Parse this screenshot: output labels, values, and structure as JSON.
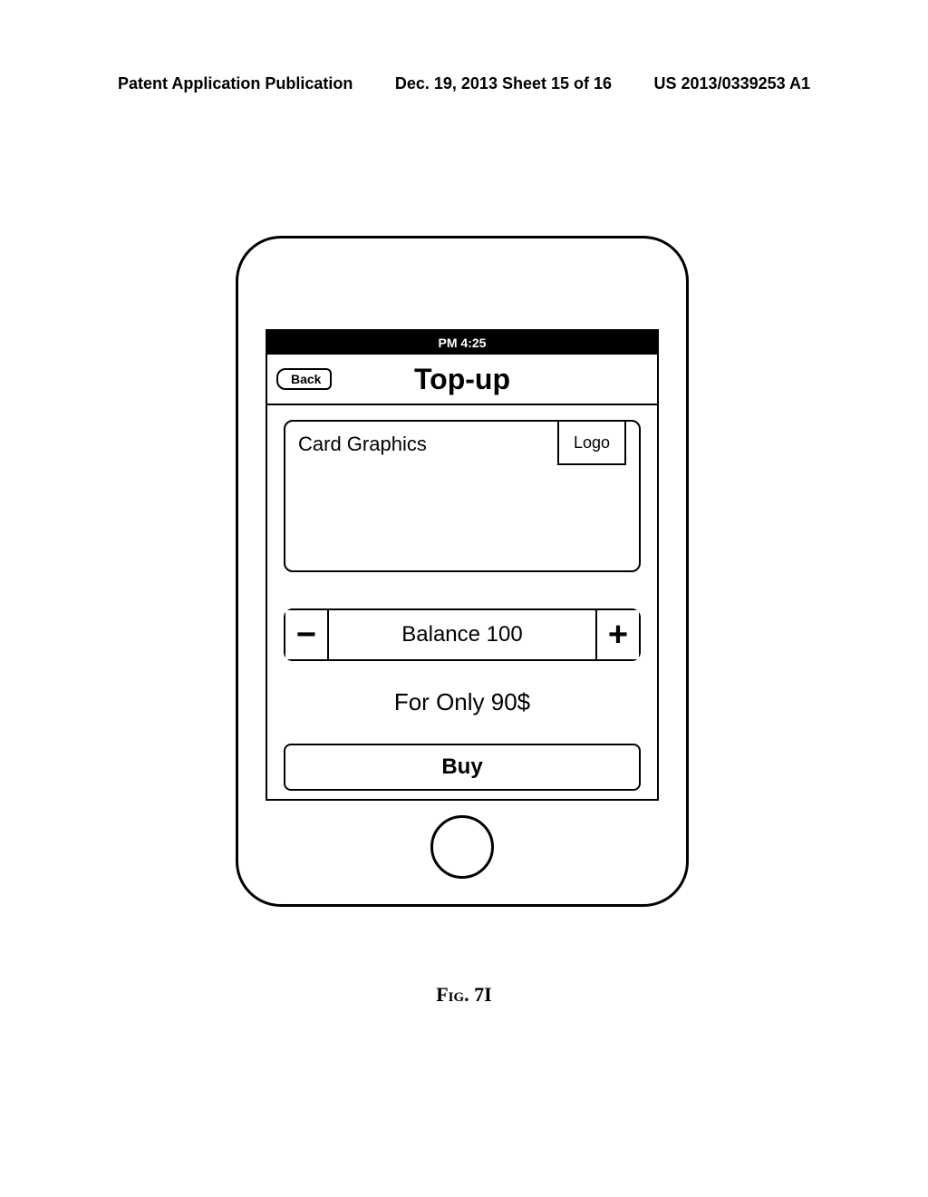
{
  "header": {
    "left": "Patent Application Publication",
    "center": "Dec. 19, 2013  Sheet 15 of 16",
    "right": "US 2013/0339253 A1"
  },
  "status": {
    "time": "PM 4:25"
  },
  "nav": {
    "back": "Back",
    "title": "Top-up"
  },
  "card": {
    "label": "Card Graphics",
    "logo": "Logo"
  },
  "balance": {
    "text": "Balance 100",
    "minus": "−",
    "plus": "+"
  },
  "price": "For Only 90$",
  "buy": "Buy",
  "figure": "Fig. 7I"
}
